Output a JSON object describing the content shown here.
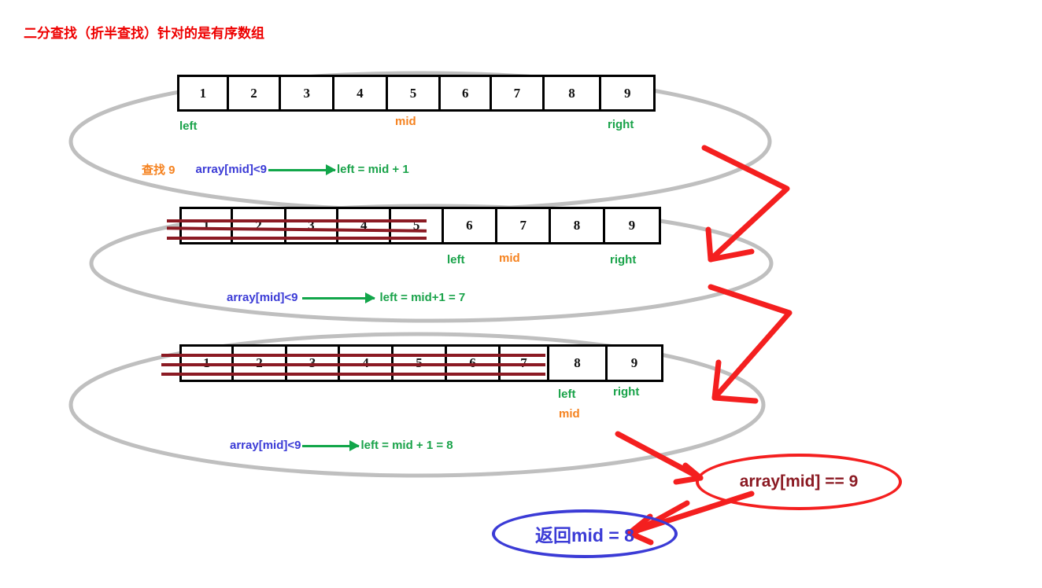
{
  "title": "二分查找（折半查找）针对的是有序数组",
  "colors": {
    "title_red": "#ee0000",
    "arrow_red": "#f41f1f",
    "strike_dark_red": "#8b1a23",
    "ellipse_gray": "#bfbfbf",
    "green": "#1aa34a",
    "orange": "#f5821f",
    "blue": "#3b3bd6"
  },
  "steps": [
    {
      "id": "step-1",
      "cells": [
        "1",
        "2",
        "3",
        "4",
        "5",
        "6",
        "7",
        "8",
        "9"
      ],
      "struck_count": 0,
      "pointers": [
        {
          "name": "left",
          "label": "left",
          "kind": "left",
          "index": 0
        },
        {
          "name": "mid",
          "label": "mid",
          "kind": "mid",
          "index": 4
        },
        {
          "name": "right",
          "label": "right",
          "kind": "right",
          "index": 8
        }
      ],
      "formula": {
        "prefix": "查找 9",
        "condition": "array[mid]<9",
        "result": "left = mid + 1"
      }
    },
    {
      "id": "step-2",
      "cells": [
        "1",
        "2",
        "3",
        "4",
        "5",
        "6",
        "7",
        "8",
        "9"
      ],
      "struck_count": 5,
      "pointers": [
        {
          "name": "left",
          "label": "left",
          "kind": "left",
          "index": 5
        },
        {
          "name": "mid",
          "label": "mid",
          "kind": "mid",
          "index": 6
        },
        {
          "name": "right",
          "label": "right",
          "kind": "right",
          "index": 8
        }
      ],
      "formula": {
        "prefix": "",
        "condition": "array[mid]<9",
        "result": "left = mid+1 = 7"
      }
    },
    {
      "id": "step-3",
      "cells": [
        "1",
        "2",
        "3",
        "4",
        "5",
        "6",
        "7",
        "8",
        "9"
      ],
      "struck_count": 7,
      "pointers": [
        {
          "name": "left",
          "label": "left",
          "kind": "left",
          "index": 7
        },
        {
          "name": "mid",
          "label": "mid",
          "kind": "mid",
          "index": 7
        },
        {
          "name": "right",
          "label": "right",
          "kind": "right",
          "index": 8
        }
      ],
      "formula": {
        "prefix": "",
        "condition": "array[mid]<9",
        "result": "left = mid + 1 = 8"
      }
    }
  ],
  "callouts": {
    "condition_match": "array[mid] == 9",
    "return_value": "返回mid = 8"
  }
}
